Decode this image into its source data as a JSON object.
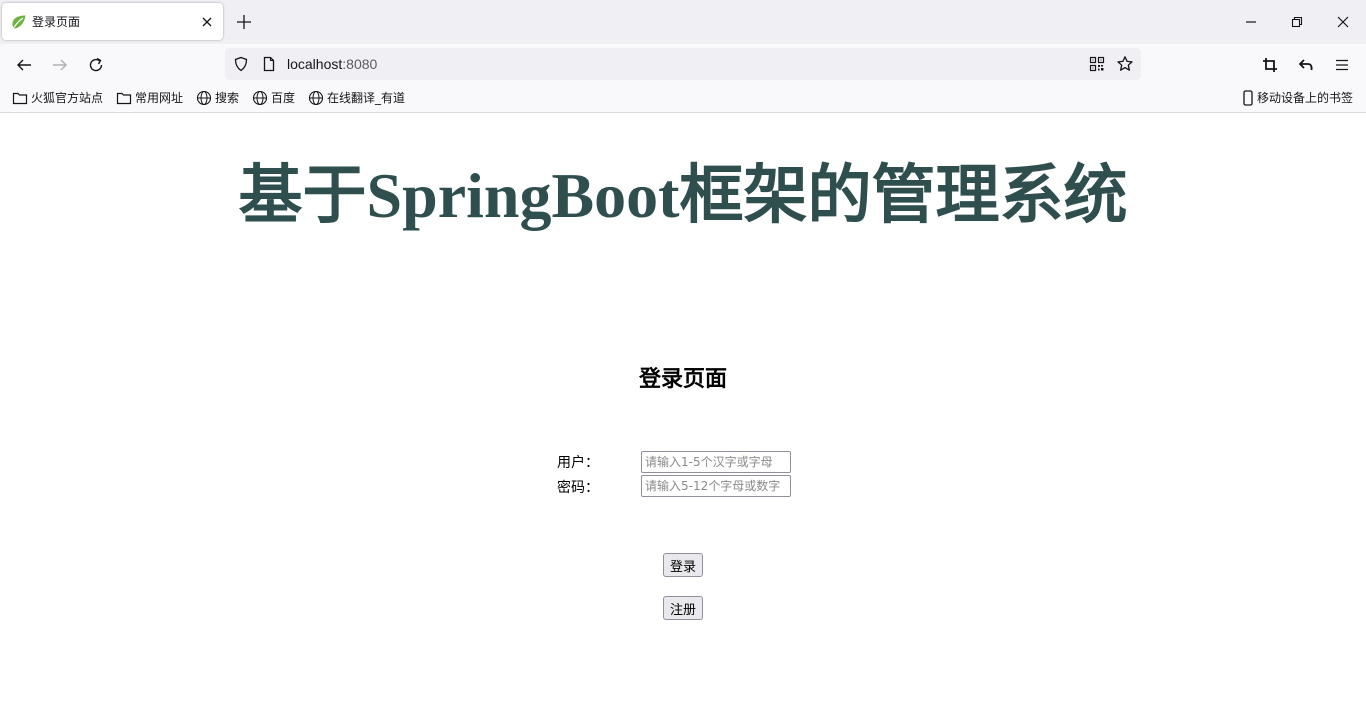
{
  "browser": {
    "tab": {
      "title": "登录页面",
      "favicon": "spring-leaf-icon"
    },
    "url": {
      "host": "localhost",
      "port": ":8080"
    },
    "bookmarks": [
      {
        "label": "火狐官方站点",
        "icon": "folder-icon"
      },
      {
        "label": "常用网址",
        "icon": "folder-icon"
      },
      {
        "label": "搜索",
        "icon": "globe-icon"
      },
      {
        "label": "百度",
        "icon": "globe-icon"
      },
      {
        "label": "在线翻译_有道",
        "icon": "globe-icon"
      }
    ],
    "mobile_bookmarks": "移动设备上的书签"
  },
  "page": {
    "title": "基于SpringBoot框架的管理系统",
    "subtitle": "登录页面",
    "form": {
      "user_label": "用户：",
      "user_placeholder": "请输入1-5个汉字或字母",
      "password_label": "密码：",
      "password_placeholder": "请输入5-12个字母或数字",
      "login_label": "登录",
      "register_label": "注册"
    }
  },
  "colors": {
    "title": "#2f4f4f",
    "chrome": "#f0f0f4",
    "toolbar": "#f9f9fb"
  }
}
